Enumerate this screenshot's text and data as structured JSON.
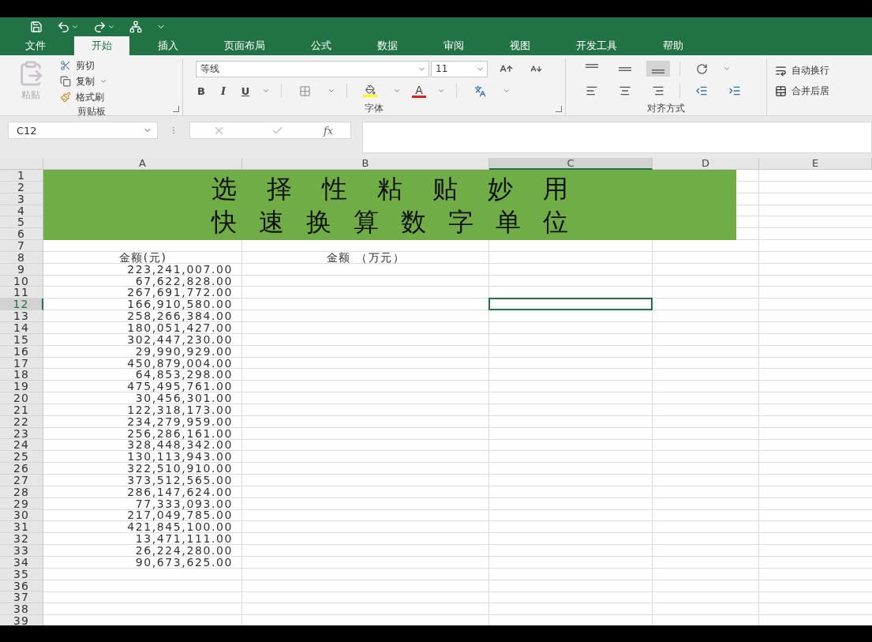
{
  "tabs": [
    {
      "label": "文件",
      "selected": false
    },
    {
      "label": "开始",
      "selected": true
    },
    {
      "label": "插入",
      "selected": false
    },
    {
      "label": "页面布局",
      "selected": false
    },
    {
      "label": "公式",
      "selected": false
    },
    {
      "label": "数据",
      "selected": false
    },
    {
      "label": "审阅",
      "selected": false
    },
    {
      "label": "视图",
      "selected": false
    },
    {
      "label": "开发工具",
      "selected": false
    },
    {
      "label": "帮助",
      "selected": false
    }
  ],
  "ribbon": {
    "clipboard": {
      "paste": "粘贴",
      "cut": "剪切",
      "copy": "复制",
      "format_painter": "格式刷",
      "label": "剪贴板"
    },
    "font": {
      "font_name": "等线",
      "font_size": "11",
      "bold": "B",
      "italic": "I",
      "underline": "U",
      "font_color": "A",
      "label": "字体"
    },
    "alignment": {
      "vertical_align": [
        {
          "selected": false
        },
        {
          "selected": false
        },
        {
          "selected": true
        }
      ],
      "wrap_text": "自动换行",
      "merge": "合并后居",
      "label": "对齐方式"
    }
  },
  "formula_bar": {
    "name_box": "C12",
    "function_label": "fx"
  },
  "sheet": {
    "columns": [
      {
        "label": "A",
        "selected": false
      },
      {
        "label": "B",
        "selected": false
      },
      {
        "label": "C",
        "selected": true
      },
      {
        "label": "D",
        "selected": false
      },
      {
        "label": "E",
        "selected": false
      }
    ],
    "rows": [
      {
        "number": "1",
        "selected": false
      },
      {
        "number": "2",
        "selected": false
      },
      {
        "number": "3",
        "selected": false
      },
      {
        "number": "4",
        "selected": false
      },
      {
        "number": "5",
        "selected": false
      },
      {
        "number": "6",
        "selected": false
      },
      {
        "number": "7",
        "selected": false
      },
      {
        "number": "8",
        "selected": false
      },
      {
        "number": "9",
        "selected": false
      },
      {
        "number": "10",
        "selected": false
      },
      {
        "number": "11",
        "selected": false
      },
      {
        "number": "12",
        "selected": true
      },
      {
        "number": "13",
        "selected": false
      },
      {
        "number": "14",
        "selected": false
      },
      {
        "number": "15",
        "selected": false
      },
      {
        "number": "16",
        "selected": false
      },
      {
        "number": "17",
        "selected": false
      },
      {
        "number": "18",
        "selected": false
      },
      {
        "number": "19",
        "selected": false
      },
      {
        "number": "20",
        "selected": false
      },
      {
        "number": "21",
        "selected": false
      },
      {
        "number": "22",
        "selected": false
      },
      {
        "number": "23",
        "selected": false
      },
      {
        "number": "24",
        "selected": false
      },
      {
        "number": "25",
        "selected": false
      },
      {
        "number": "26",
        "selected": false
      },
      {
        "number": "27",
        "selected": false
      },
      {
        "number": "28",
        "selected": false
      },
      {
        "number": "29",
        "selected": false
      },
      {
        "number": "30",
        "selected": false
      },
      {
        "number": "31",
        "selected": false
      },
      {
        "number": "32",
        "selected": false
      },
      {
        "number": "33",
        "selected": false
      },
      {
        "number": "34",
        "selected": false
      },
      {
        "number": "35",
        "selected": false
      },
      {
        "number": "36",
        "selected": false
      },
      {
        "number": "37",
        "selected": false
      },
      {
        "number": "38",
        "selected": false
      },
      {
        "number": "39",
        "selected": false
      }
    ],
    "title_lines": [
      "选择性粘贴妙用",
      "快速换算数字单位"
    ],
    "header_row": [
      "金额(元)",
      "金额 （万元）"
    ],
    "amounts": [
      "223,241,007.00",
      "67,622,828.00",
      "267,691,772.00",
      "166,910,580.00",
      "258,266,384.00",
      "180,051,427.00",
      "302,447,230.00",
      "29,990,929.00",
      "450,879,004.00",
      "64,853,298.00",
      "475,495,761.00",
      "30,456,301.00",
      "122,318,173.00",
      "234,279,959.00",
      "256,286,161.00",
      "328,448,342.00",
      "130,113,943.00",
      "322,510,910.00",
      "373,512,565.00",
      "286,147,624.00",
      "77,333,093.00",
      "217,049,785.00",
      "421,845,100.00",
      "13,471,111.00",
      "26,224,280.00",
      "90,673,625.00"
    ]
  }
}
